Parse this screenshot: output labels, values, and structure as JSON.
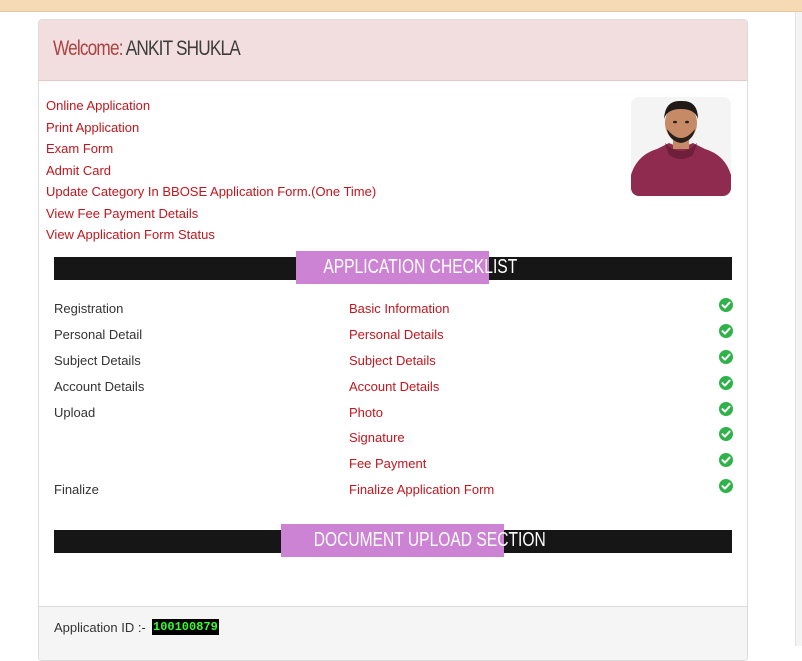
{
  "header": {
    "welcome_label": "Welcome:",
    "user_name": "ANKIT SHUKLA"
  },
  "links": [
    "Online Application",
    "Print Application",
    "Exam Form",
    "Admit Card",
    "Update Category In BBOSE Application Form.(One Time)",
    "View Fee Payment Details",
    "View Application Form Status"
  ],
  "checklist": {
    "title": "APPLICATION CHECKLIST",
    "rows": [
      {
        "step": "Registration",
        "item": "Basic Information",
        "done": true
      },
      {
        "step": "Personal Detail",
        "item": "Personal Details",
        "done": true
      },
      {
        "step": "Subject Details",
        "item": "Subject Details",
        "done": true
      },
      {
        "step": "Account Details",
        "item": "Account Details",
        "done": true
      },
      {
        "step": "Upload",
        "item": "Photo",
        "done": true
      },
      {
        "step": "",
        "item": "Signature",
        "done": true
      },
      {
        "step": "",
        "item": "Fee Payment",
        "done": true
      },
      {
        "step": "Finalize",
        "item": "Finalize Application Form",
        "done": true
      }
    ]
  },
  "document_section": {
    "title": "DOCUMENT UPLOAD SECTION"
  },
  "footer": {
    "app_id_label": "Application ID :-",
    "app_id_value": "100100879"
  },
  "colors": {
    "link_red": "#c0161d",
    "header_bg": "#f2dede",
    "section_title_bg": "#cc83d3",
    "check_green": "#2fb24a",
    "app_id_text": "#37ff2e"
  },
  "icons": {
    "check": "check-circle-icon",
    "photo": "user-photo"
  }
}
